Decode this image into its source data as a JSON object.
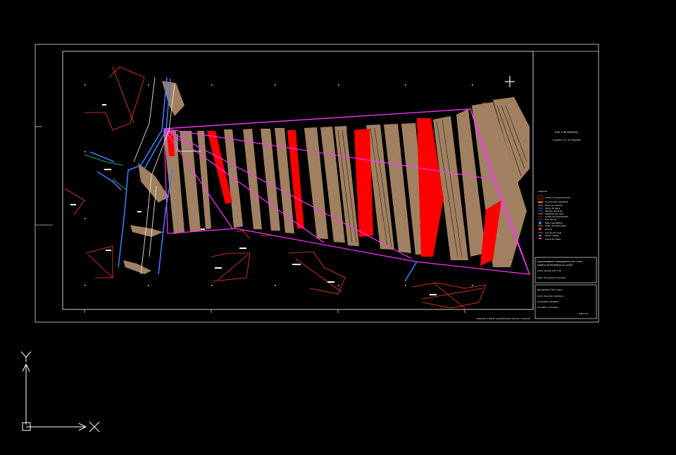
{
  "drawing": {
    "title_block": {
      "project_title": "Scal 1 do Desenho",
      "project_sub": "Levanta. to T. de Topgrafia",
      "legend_heading": "Legenda",
      "legend_items": [
        "Limite do levantamento",
        "Arruamento existente",
        "Muro de suporte",
        "Linha de água",
        "Talude / escarpa",
        "Vedação em rede",
        "Limite de propriedade",
        "Eixo da via",
        "Marco geodésico",
        "Poste de iluminação",
        "Árvore",
        "Curvas de nível",
        "Ponto cotado",
        "Caixa de visita"
      ],
      "main_title": "LEVANTAMENTO TOPOGRAFICO  ESC 1:200",
      "main_title_2": "ACERTO DE ESTREMAS AO LIMITE",
      "scale_note": "Folha: Escala 1/Ft 1.25",
      "date_note": "Data: 00 de Junho de 2012",
      "owner": "Requerente: Vítor Henri",
      "location": "Local: Rua das Carolinas",
      "parish": "Localidade: Penafiel",
      "county": "Concelho: Concelho",
      "sheet": "Folha 1/1",
      "footnote": "Desenho e Notas: Levantamento técnico conforme"
    },
    "colors": {
      "background": "#000000",
      "frame": "#b0b0b0",
      "contour_fill": "#a08060",
      "highlight_red": "#ff0000",
      "boundary_magenta": "#ff33ff",
      "road_blue": "#3a7bff",
      "ucs_white": "#ffffff"
    },
    "ucs_icon": {
      "x_label": "X",
      "y_label": "Y"
    }
  }
}
